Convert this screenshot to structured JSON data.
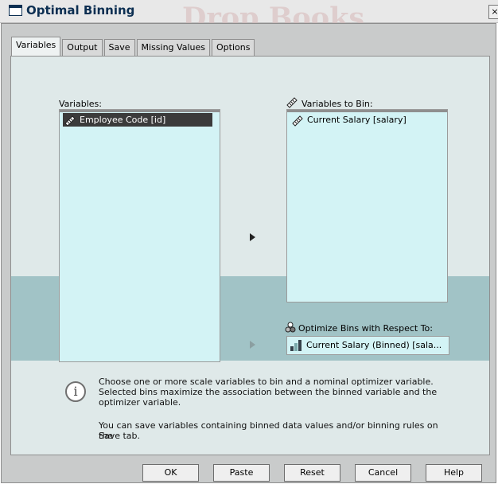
{
  "window": {
    "title": "Optimal Binning",
    "close": "×"
  },
  "tabs": [
    "Variables",
    "Output",
    "Save",
    "Missing Values",
    "Options"
  ],
  "variables": {
    "label": "Variables:",
    "items": [
      "Employee Code [id]"
    ]
  },
  "to_bin": {
    "label": "Variables to Bin:",
    "items": [
      "Current Salary [salary]"
    ]
  },
  "optimize": {
    "label": "Optimize Bins with Respect To:",
    "value": "Current Salary (Binned) [sala..."
  },
  "info": {
    "line1": "Choose one or more scale variables to bin and a nominal optimizer variable.",
    "line2": "Selected bins maximize the association between the binned variable and the",
    "line3": "optimizer variable.",
    "line4": "You can save variables containing binned data values and/or binning rules on the",
    "line5": "Save tab."
  },
  "buttons": {
    "ok": "OK",
    "paste": "Paste",
    "reset": "Reset",
    "cancel": "Cancel",
    "help": "Help"
  },
  "watermark": "Drop Books",
  "icons": {
    "close": "close-icon",
    "ruler": "ruler-icon",
    "info": "info-icon",
    "bar": "bar-chart-icon"
  }
}
